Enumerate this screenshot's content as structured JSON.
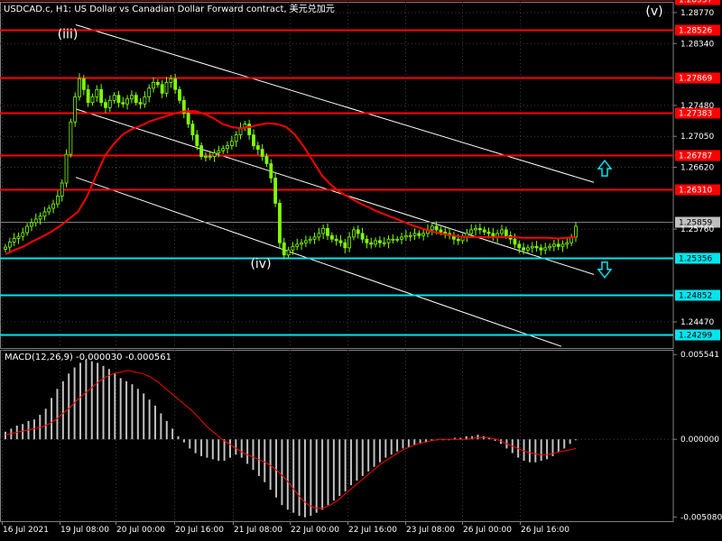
{
  "header": {
    "title": "USDCAD.c, H1:  US Dollar vs Canadian Dollar Forward contract, 美元兑加元",
    "macd_label": "MACD(12,26,9) -0.000030 -0.000561"
  },
  "colors": {
    "background": "#000000",
    "grid": "#3c3c3c",
    "candle": "#7fff00",
    "ma": "#ff0000",
    "resistance": "#ff0000",
    "support": "#00e5ee",
    "channel": "#ffffff",
    "histogram": "#c0c0c0",
    "signal": "#ff0000",
    "price_tag": "#c0c0c0"
  },
  "chart_data": [
    {
      "type": "candlestick",
      "symbol": "USDCAD.c",
      "timeframe": "H1",
      "price_axis_ticks": [
        "1.28770",
        "1.28340",
        "1.27480",
        "1.27050",
        "1.26620",
        "1.25760",
        "1.24470"
      ],
      "ylim": [
        1.2417,
        1.2908
      ],
      "x_ticks": [
        "16 Jul 2021",
        "19 Jul 08:00",
        "20 Jul 00:00",
        "20 Jul 16:00",
        "21 Jul 08:00",
        "22 Jul 00:00",
        "22 Jul 16:00",
        "23 Jul 08:00",
        "26 Jul 00:00",
        "26 Jul 16:00"
      ],
      "current_price": {
        "value": 1.25859,
        "label": "1.25859"
      },
      "resistance_lines": [
        {
          "value": 1.28957,
          "label": "1.28957"
        },
        {
          "value": 1.28526,
          "label": "1.28526"
        },
        {
          "value": 1.27869,
          "label": "1.27869"
        },
        {
          "value": 1.27383,
          "label": "1.27383"
        },
        {
          "value": 1.26787,
          "label": "1.26787"
        },
        {
          "value": 1.2631,
          "label": "1.26310"
        }
      ],
      "support_lines": [
        {
          "value": 1.25356,
          "label": "1.25356"
        },
        {
          "value": 1.24852,
          "label": "1.24852"
        },
        {
          "value": 1.24299,
          "label": "1.24299"
        }
      ],
      "close_series": [
        1.2551,
        1.2558,
        1.2563,
        1.2566,
        1.2571,
        1.258,
        1.2585,
        1.259,
        1.2594,
        1.26,
        1.2605,
        1.2611,
        1.2622,
        1.264,
        1.268,
        1.2725,
        1.276,
        1.2785,
        1.277,
        1.2752,
        1.276,
        1.277,
        1.2752,
        1.2745,
        1.2755,
        1.2762,
        1.2752,
        1.275,
        1.2757,
        1.2762,
        1.2752,
        1.275,
        1.276,
        1.2772,
        1.278,
        1.2777,
        1.2765,
        1.278,
        1.2785,
        1.277,
        1.2755,
        1.2737,
        1.2722,
        1.2707,
        1.2692,
        1.2677,
        1.2677,
        1.2677,
        1.2682,
        1.2685,
        1.2688,
        1.2692,
        1.2698,
        1.2707,
        1.2717,
        1.2722,
        1.2707,
        1.2692,
        1.2687,
        1.2677,
        1.2667,
        1.2647,
        1.2612,
        1.2557,
        1.254,
        1.2547,
        1.2552,
        1.2555,
        1.2557,
        1.256,
        1.2562,
        1.2565,
        1.257,
        1.2577,
        1.2567,
        1.2562,
        1.256,
        1.2557,
        1.255,
        1.2565,
        1.2575,
        1.257,
        1.2562,
        1.2557,
        1.2555,
        1.256,
        1.2557,
        1.2557,
        1.2562,
        1.2562,
        1.2562,
        1.2565,
        1.2567,
        1.2567,
        1.257,
        1.2567,
        1.257,
        1.2575,
        1.258,
        1.2575,
        1.2572,
        1.257,
        1.2567,
        1.2562,
        1.256,
        1.2565,
        1.257,
        1.2575,
        1.2577,
        1.2575,
        1.2572,
        1.257,
        1.2565,
        1.257,
        1.2575,
        1.2567,
        1.2562,
        1.2555,
        1.255,
        1.2547,
        1.255,
        1.2552,
        1.255,
        1.2547,
        1.255,
        1.2552,
        1.2555,
        1.2552,
        1.2555,
        1.2557,
        1.2565,
        1.258
      ],
      "ma_series": [
        1.2541,
        1.2547,
        1.2552,
        1.2559,
        1.2565,
        1.2572,
        1.258,
        1.259,
        1.26,
        1.2621,
        1.265,
        1.2678,
        1.2695,
        1.2708,
        1.2715,
        1.272,
        1.2726,
        1.273,
        1.2734,
        1.2738,
        1.274,
        1.274,
        1.2736,
        1.273,
        1.2722,
        1.2718,
        1.2716,
        1.2718,
        1.2721,
        1.2723,
        1.2722,
        1.2718,
        1.2707,
        1.269,
        1.267,
        1.265,
        1.2637,
        1.2627,
        1.262,
        1.2613,
        1.2607,
        1.2601,
        1.2596,
        1.2591,
        1.2586,
        1.2581,
        1.2577,
        1.2573,
        1.257,
        1.2568,
        1.2566,
        1.2565,
        1.2565,
        1.2565,
        1.2565,
        1.2565,
        1.2565,
        1.2564,
        1.2564,
        1.2564,
        1.2564,
        1.2563,
        1.2564,
        1.2565
      ],
      "annotations": [
        "(iii)",
        "(iv)",
        "(v)"
      ]
    },
    {
      "type": "macd",
      "name": "MACD(12,26,9)",
      "values": {
        "macd": -3e-05,
        "signal": -0.000561
      },
      "axis_ticks": [
        "0.005541",
        "0.000000",
        "-0.005080"
      ],
      "ylim": [
        -0.00535,
        0.00585
      ],
      "histogram": [
        0.0005,
        0.0007,
        0.0009,
        0.001,
        0.0012,
        0.0013,
        0.0016,
        0.002,
        0.0027,
        0.0033,
        0.0038,
        0.0043,
        0.0047,
        0.005,
        0.0052,
        0.0051,
        0.005,
        0.0048,
        0.0046,
        0.0043,
        0.004,
        0.0038,
        0.0036,
        0.0033,
        0.003,
        0.0026,
        0.0022,
        0.0017,
        0.0012,
        0.0007,
        0.0002,
        -0.0002,
        -0.0006,
        -0.0009,
        -0.0011,
        -0.0012,
        -0.0013,
        -0.0014,
        -0.0014,
        -0.0012,
        -0.001,
        -0.0012,
        -0.0016,
        -0.002,
        -0.0024,
        -0.0028,
        -0.0033,
        -0.0038,
        -0.0043,
        -0.0046,
        -0.0048,
        -0.005,
        -0.0051,
        -0.005,
        -0.0048,
        -0.0046,
        -0.0043,
        -0.004,
        -0.0037,
        -0.0034,
        -0.003,
        -0.0027,
        -0.0024,
        -0.0021,
        -0.0018,
        -0.0015,
        -0.0012,
        -0.001,
        -0.0008,
        -0.0006,
        -0.0005,
        -0.0004,
        -0.0003,
        -0.0002,
        -0.0001,
        0.0,
        0.0,
        0.0,
        0.0001,
        0.0001,
        0.0002,
        0.0002,
        0.0003,
        0.0002,
        0.0001,
        -0.0001,
        -0.0003,
        -0.0006,
        -0.0009,
        -0.0012,
        -0.0014,
        -0.0015,
        -0.0015,
        -0.0014,
        -0.0013,
        -0.0011,
        -0.0008,
        -0.0006,
        -0.0003,
        0.0
      ],
      "signal_series": [
        0.0003,
        0.0004,
        0.0005,
        0.0006,
        0.0007,
        0.0008,
        0.001,
        0.0013,
        0.0017,
        0.0021,
        0.0026,
        0.003,
        0.0034,
        0.0038,
        0.0041,
        0.0043,
        0.0044,
        0.0045,
        0.0044,
        0.0043,
        0.0041,
        0.0038,
        0.0034,
        0.003,
        0.0026,
        0.0022,
        0.0018,
        0.0013,
        0.0008,
        0.0004,
        0.0,
        -0.0003,
        -0.0006,
        -0.0009,
        -0.0011,
        -0.0013,
        -0.0015,
        -0.0018,
        -0.0022,
        -0.0027,
        -0.0033,
        -0.0039,
        -0.0043,
        -0.0045,
        -0.0045,
        -0.0043,
        -0.004,
        -0.0036,
        -0.0032,
        -0.0028,
        -0.0024,
        -0.002,
        -0.0016,
        -0.0013,
        -0.001,
        -0.0007,
        -0.0005,
        -0.0003,
        -0.0002,
        -0.0001,
        0.0,
        0.0,
        0.0,
        0.0,
        0.0,
        0.0001,
        0.0001,
        0.0001,
        0.0,
        -0.0002,
        -0.0004,
        -0.0006,
        -0.0008,
        -0.0009,
        -0.001,
        -0.001,
        -0.0009,
        -0.0008,
        -0.0007,
        -0.0006
      ]
    }
  ]
}
